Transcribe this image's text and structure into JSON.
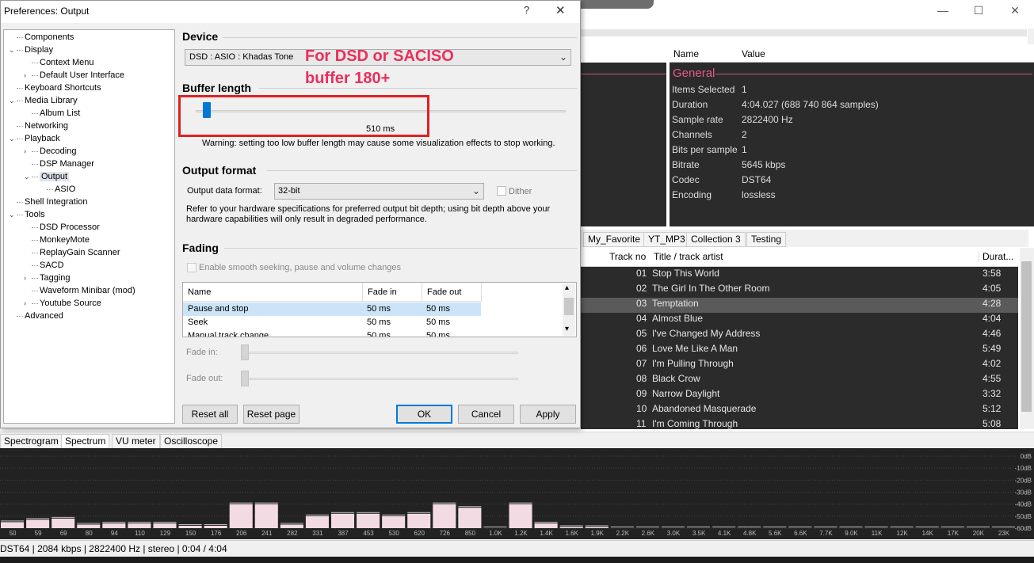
{
  "dialog": {
    "title": "Preferences: Output",
    "help_glyph": "?",
    "close_glyph": "✕",
    "tree": [
      {
        "label": "Components",
        "depth": 0,
        "expander": ""
      },
      {
        "label": "Display",
        "depth": 0,
        "expander": "v"
      },
      {
        "label": "Context Menu",
        "depth": 1,
        "expander": ""
      },
      {
        "label": "Default User Interface",
        "depth": 1,
        "expander": ">"
      },
      {
        "label": "Keyboard Shortcuts",
        "depth": 0,
        "expander": ""
      },
      {
        "label": "Media Library",
        "depth": 0,
        "expander": "v"
      },
      {
        "label": "Album List",
        "depth": 1,
        "expander": ""
      },
      {
        "label": "Networking",
        "depth": 0,
        "expander": ""
      },
      {
        "label": "Playback",
        "depth": 0,
        "expander": "v"
      },
      {
        "label": "Decoding",
        "depth": 1,
        "expander": ">"
      },
      {
        "label": "DSP Manager",
        "depth": 1,
        "expander": ""
      },
      {
        "label": "Output",
        "depth": 1,
        "expander": "v",
        "selected": true
      },
      {
        "label": "ASIO",
        "depth": 2,
        "expander": ""
      },
      {
        "label": "Shell Integration",
        "depth": 0,
        "expander": ""
      },
      {
        "label": "Tools",
        "depth": 0,
        "expander": "v"
      },
      {
        "label": "DSD Processor",
        "depth": 1,
        "expander": ""
      },
      {
        "label": "MonkeyMote",
        "depth": 1,
        "expander": ""
      },
      {
        "label": "ReplayGain Scanner",
        "depth": 1,
        "expander": ""
      },
      {
        "label": "SACD",
        "depth": 1,
        "expander": ""
      },
      {
        "label": "Tagging",
        "depth": 1,
        "expander": ">"
      },
      {
        "label": "Waveform Minibar (mod)",
        "depth": 1,
        "expander": ""
      },
      {
        "label": "Youtube Source",
        "depth": 1,
        "expander": ">"
      },
      {
        "label": "Advanced",
        "depth": 0,
        "expander": ""
      }
    ],
    "device": {
      "heading": "Device",
      "selected": "DSD : ASIO : Khadas Tone"
    },
    "buffer": {
      "heading": "Buffer length",
      "value_label": "510 ms",
      "slider_fraction": 0.02,
      "warning": "Warning: setting too low buffer length may cause some visualization effects to stop working."
    },
    "annotation": {
      "line1": "For DSD or SACISO",
      "line2": "buffer 180+",
      "color": "#e8305a",
      "box_color": "#e02020"
    },
    "output_format": {
      "heading": "Output format",
      "label": "Output data format:",
      "selected": "32-bit",
      "dither_label": "Dither",
      "note": "Refer to your hardware specifications for preferred output bit depth; using bit depth above your hardware capabilities will only result in degraded performance."
    },
    "fading": {
      "heading": "Fading",
      "smooth_label": "Enable smooth seeking, pause and volume changes",
      "columns": [
        "Name",
        "Fade in",
        "Fade out"
      ],
      "rows": [
        {
          "name": "Pause and stop",
          "fade_in": "50 ms",
          "fade_out": "50 ms"
        },
        {
          "name": "Seek",
          "fade_in": "50 ms",
          "fade_out": "50 ms"
        },
        {
          "name": "Manual track change",
          "fade_in": "50 ms",
          "fade_out": "50 ms"
        }
      ],
      "fade_in_label": "Fade in:",
      "fade_out_label": "Fade out:"
    },
    "buttons": {
      "reset_all": "Reset all",
      "reset_page": "Reset page",
      "ok": "OK",
      "cancel": "Cancel",
      "apply": "Apply"
    }
  },
  "window": {
    "minimize": "—",
    "maximize": "☐",
    "close": "✕"
  },
  "properties": {
    "columns": [
      "Name",
      "Value"
    ],
    "group": "General",
    "rows": [
      {
        "k": "Items Selected",
        "v": "1"
      },
      {
        "k": "Duration",
        "v": "4:04.027 (688 740 864 samples)"
      },
      {
        "k": "Sample rate",
        "v": "2822400 Hz"
      },
      {
        "k": "Channels",
        "v": "2"
      },
      {
        "k": "Bits per sample",
        "v": "1"
      },
      {
        "k": "Bitrate",
        "v": "5645 kbps"
      },
      {
        "k": "Codec",
        "v": "DST64"
      },
      {
        "k": "Encoding",
        "v": "lossless"
      }
    ]
  },
  "playlist": {
    "tabs": [
      "My_Favorite",
      "YT_MP3",
      "Collection 3",
      "Testing"
    ],
    "columns": [
      "Track no",
      "Title / track artist",
      "Durat..."
    ],
    "tracks": [
      {
        "no": "01",
        "title": "Stop This World",
        "dur": "3:58"
      },
      {
        "no": "02",
        "title": "The Girl In The Other Room",
        "dur": "4:05"
      },
      {
        "no": "03",
        "title": "Temptation",
        "dur": "4:28",
        "selected": true
      },
      {
        "no": "04",
        "title": "Almost Blue",
        "dur": "4:04"
      },
      {
        "no": "05",
        "title": "I've Changed My Address",
        "dur": "4:46"
      },
      {
        "no": "06",
        "title": "Love Me Like A Man",
        "dur": "5:49"
      },
      {
        "no": "07",
        "title": "I'm Pulling Through",
        "dur": "4:02"
      },
      {
        "no": "08",
        "title": "Black Crow",
        "dur": "4:55"
      },
      {
        "no": "09",
        "title": "Narrow Daylight",
        "dur": "3:32"
      },
      {
        "no": "10",
        "title": "Abandoned Masquerade",
        "dur": "5:12"
      },
      {
        "no": "11",
        "title": "I'm Coming Through",
        "dur": "5:08"
      }
    ]
  },
  "visualizer": {
    "tabs": [
      "Spectrogram",
      "Spectrum",
      "VU meter",
      "Oscilloscope"
    ],
    "active_tab": "Spectrum",
    "db_labels": [
      "0dB",
      "-10dB",
      "-20dB",
      "-30dB",
      "-40dB",
      "-50dB",
      "-60dB"
    ],
    "freq_labels": [
      "50",
      "59",
      "69",
      "80",
      "94",
      "110",
      "129",
      "150",
      "176",
      "206",
      "241",
      "282",
      "331",
      "387",
      "453",
      "530",
      "620",
      "726",
      "850",
      "1.0K",
      "1.2K",
      "1.4K",
      "1.6K",
      "1.9K",
      "2.2K",
      "2.6K",
      "3.0K",
      "3.5K",
      "4.1K",
      "4.8K",
      "5.6K",
      "6.6K",
      "7.7K",
      "9.0K",
      "11K",
      "12K",
      "14K",
      "17K",
      "20K",
      "23K"
    ],
    "band_levels_db": [
      -55,
      -53,
      -52,
      -57,
      -56,
      -56,
      -56,
      -58,
      -58,
      -40,
      -40,
      -57,
      -50,
      -48,
      -48,
      -50,
      -48,
      -40,
      -43,
      -60,
      -40,
      -56,
      -59,
      -59,
      -60,
      -60,
      -60,
      -60,
      -60,
      -60,
      -60,
      -60,
      -60,
      -60,
      -60,
      -60,
      -60,
      -60,
      -60,
      -60
    ],
    "band_colors": {
      "bar": "#f2dbe3",
      "cap": "#c0c0c0"
    }
  },
  "status": {
    "text": "DST64 | 2084 kbps | 2822400 Hz | stereo | 0:04 / 4:04"
  }
}
